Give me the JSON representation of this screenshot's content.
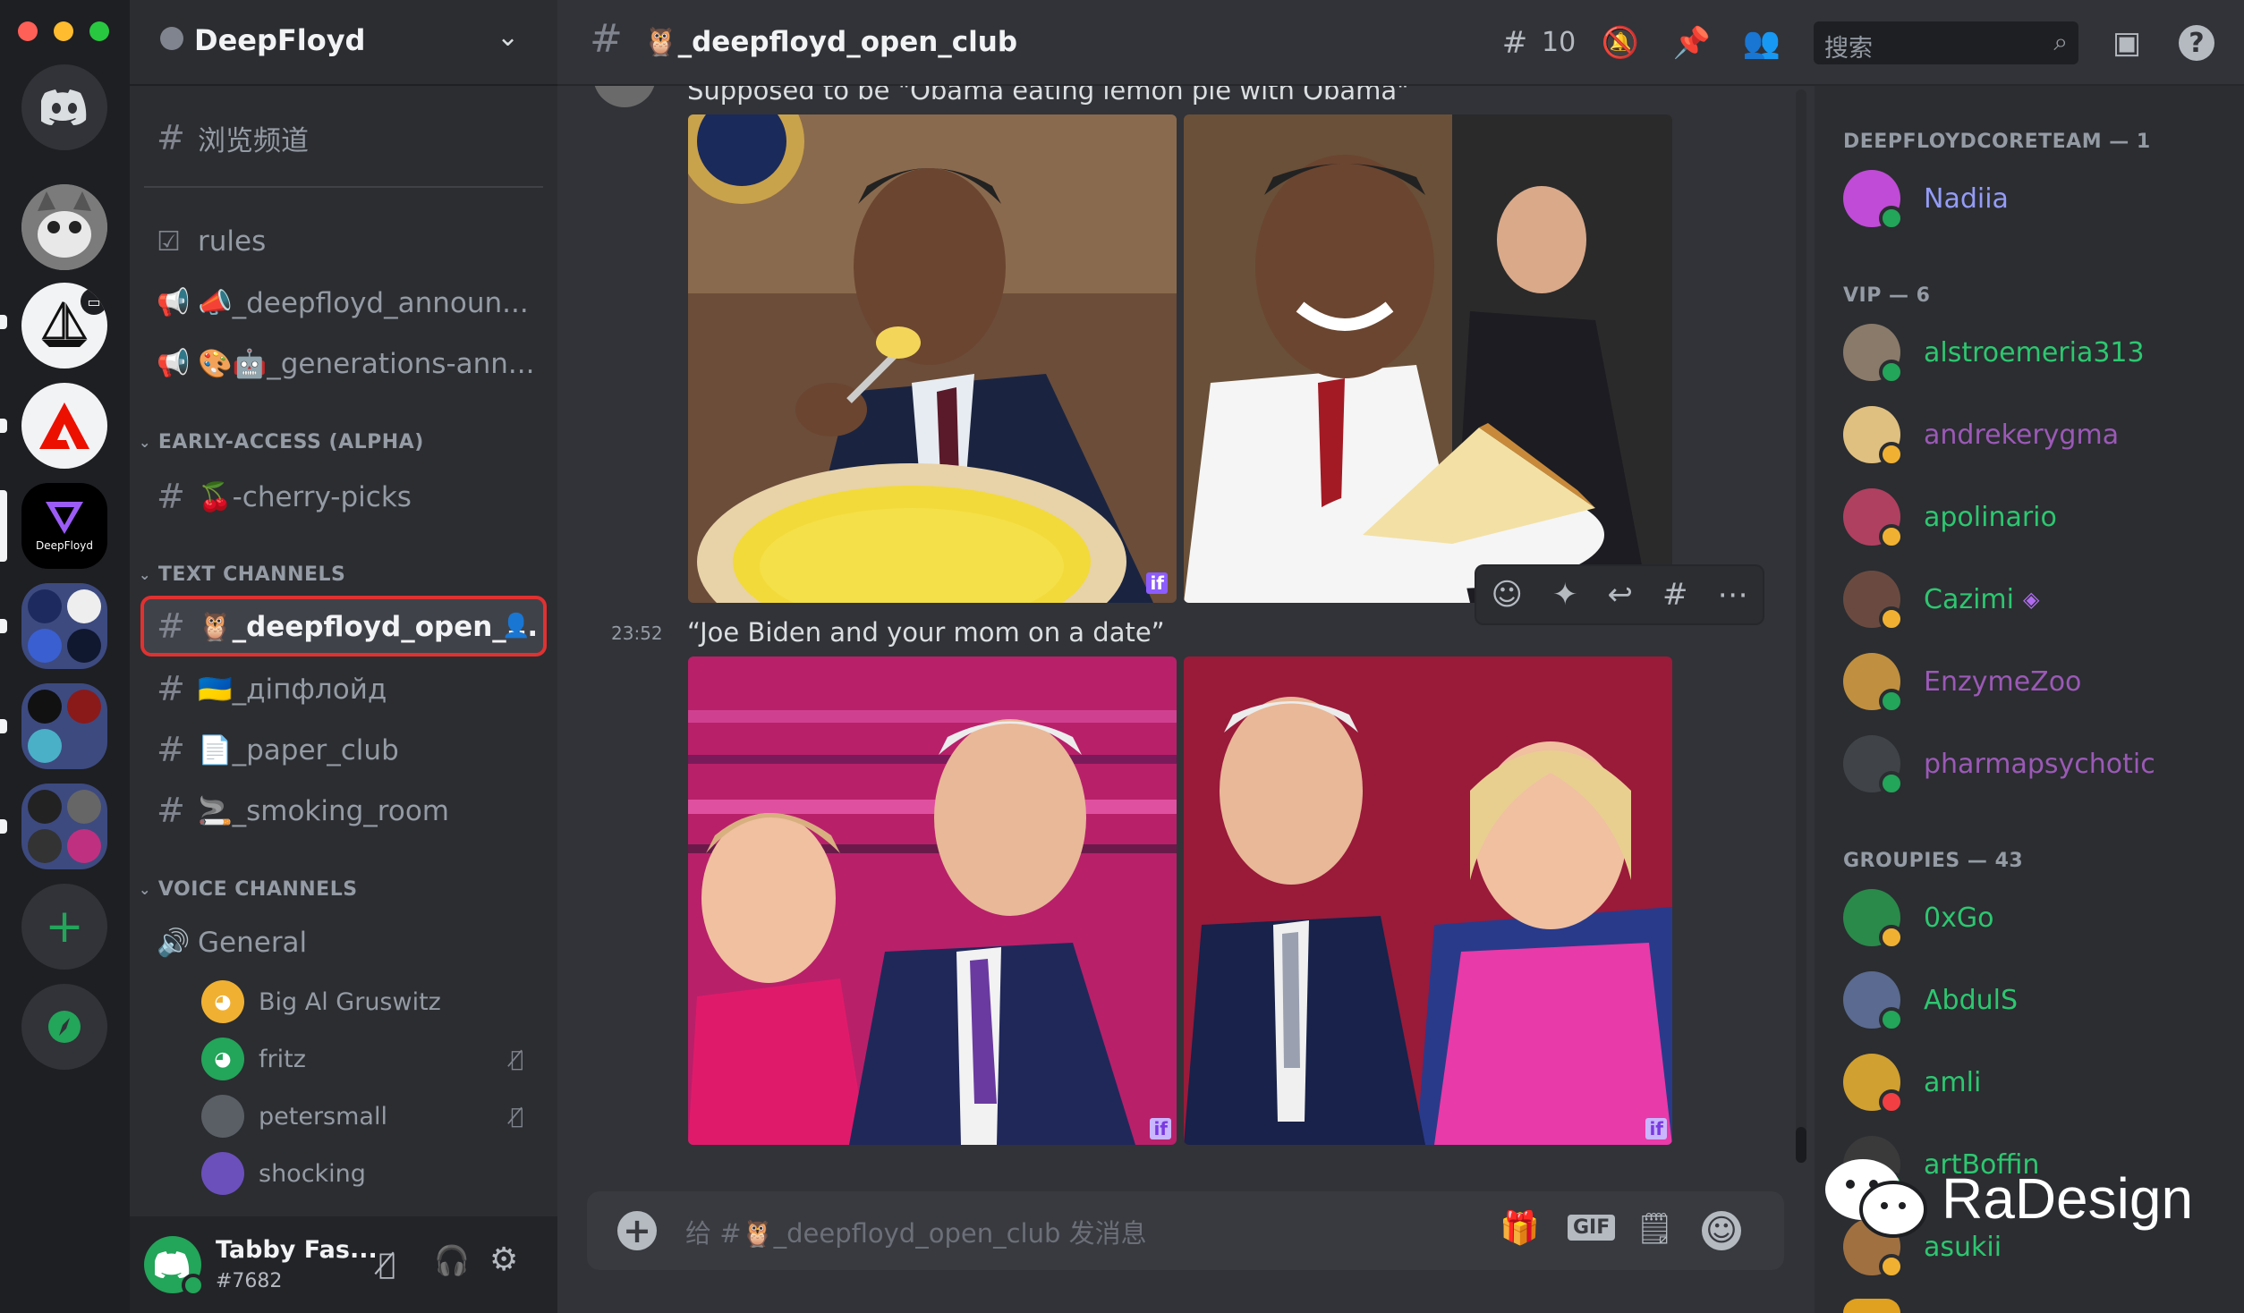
{
  "server": {
    "name": "DeepFloyd"
  },
  "rail": {
    "deepfloyd_label": "DeepFloyd"
  },
  "sidebar": {
    "browse": "浏览频道",
    "channels_top": [
      {
        "name": "rules"
      },
      {
        "name": "📣_deepfloyd_announ..."
      },
      {
        "name": "🎨🤖_generations-ann..."
      }
    ],
    "early_access": {
      "label": "EARLY-ACCESS (ALPHA)",
      "channel": "🍒-cherry-picks"
    },
    "text_channels": {
      "label": "TEXT CHANNELS",
      "items": [
        {
          "name": "🦉_deepfloyd_open_..."
        },
        {
          "name": "🇺🇦_дiпфлойд"
        },
        {
          "name": "📄_paper_club"
        },
        {
          "name": "🚬_smoking_room"
        }
      ]
    },
    "voice_channels": {
      "label": "VOICE CHANNELS",
      "general": "General",
      "users": [
        {
          "name": "Big Al Gruswitz",
          "color": "#f0b132"
        },
        {
          "name": "fritz",
          "color": "#23a55a"
        },
        {
          "name": "petersmall",
          "color": "#5a5f66"
        },
        {
          "name": "shocking",
          "color": "#6b4fbb"
        }
      ]
    }
  },
  "user": {
    "name": "Tabby Fas...",
    "tag": "#7682"
  },
  "header": {
    "channel": "🦉_deepfloyd_open_club",
    "threads_count": "10",
    "search_placeholder": "搜索"
  },
  "messages": [
    {
      "time": "",
      "text": "Supposed to be \"Obama eating lemon pie with Obama\""
    },
    {
      "time": "23:52",
      "text": "“Joe Biden and your mom on a date”"
    }
  ],
  "image_badge": "if",
  "composer": {
    "placeholder": "给 #🦉_deepfloyd_open_club 发消息",
    "gif": "GIF"
  },
  "members": {
    "groups": [
      {
        "label": "DEEPFLOYDCORETEAM — 1",
        "items": [
          {
            "name": "Nadiia",
            "color": "#949cf7",
            "avatar": "#c04bd6",
            "status": "#23a55a"
          }
        ]
      },
      {
        "label": "VIP — 6",
        "items": [
          {
            "name": "alstroemeria313",
            "color": "#2dc770",
            "avatar": "#8a7a6a",
            "status": "#23a55a"
          },
          {
            "name": "andrekerygma",
            "color": "#9b59b6",
            "avatar": "#e0c080",
            "status": "#f0b132"
          },
          {
            "name": "apolinario",
            "color": "#2dc770",
            "avatar": "#b04060",
            "status": "#f0b132"
          },
          {
            "name": "Cazimi",
            "color": "#2dc770",
            "avatar": "#6a4a40",
            "status": "#f0b132"
          },
          {
            "name": "EnzymeZoo",
            "color": "#9b59b6",
            "avatar": "#c09040",
            "status": "#23a55a"
          },
          {
            "name": "pharmapsychotic",
            "color": "#9b59b6",
            "avatar": "#404448",
            "status": "#23a55a"
          }
        ]
      },
      {
        "label": "GROUPIES — 43",
        "items": [
          {
            "name": "0xGo",
            "color": "#2dc770",
            "avatar": "#2a8a4a",
            "status": "#f0b132"
          },
          {
            "name": "AbdulS",
            "color": "#2dc770",
            "avatar": "#5a6a90",
            "status": "#23a55a"
          },
          {
            "name": "amli",
            "color": "#2dc770",
            "avatar": "#d0a030",
            "status": "#f23f43"
          },
          {
            "name": "artBoffin",
            "color": "#2dc770",
            "avatar": "#3a3a3a",
            "status": "#23a55a"
          },
          {
            "name": "asukii",
            "color": "#2dc770",
            "avatar": "#a07040",
            "status": "#f0b132"
          }
        ]
      }
    ]
  },
  "watermark": "RaDesign"
}
